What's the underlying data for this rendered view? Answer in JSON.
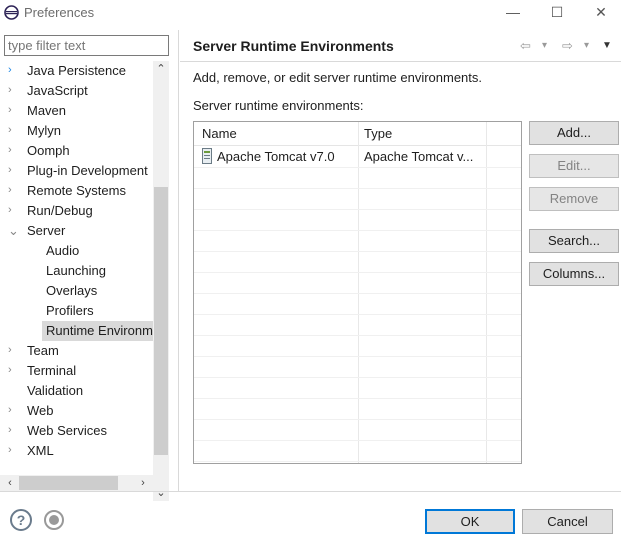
{
  "window": {
    "title": "Preferences",
    "minimize_glyph": "—",
    "maximize_glyph": "☐",
    "close_glyph": "✕"
  },
  "filter": {
    "placeholder": "type filter text",
    "value": ""
  },
  "tree": {
    "items": [
      {
        "label": "Java Persistence",
        "level": 0,
        "expander": "›",
        "expanded": false,
        "selected": false
      },
      {
        "label": "JavaScript",
        "level": 0,
        "expander": "›",
        "expanded": false,
        "selected": false
      },
      {
        "label": "Maven",
        "level": 0,
        "expander": "›",
        "expanded": false,
        "selected": false
      },
      {
        "label": "Mylyn",
        "level": 0,
        "expander": "›",
        "expanded": false,
        "selected": false
      },
      {
        "label": "Oomph",
        "level": 0,
        "expander": "›",
        "expanded": false,
        "selected": false
      },
      {
        "label": "Plug-in Development",
        "level": 0,
        "expander": "›",
        "expanded": false,
        "selected": false
      },
      {
        "label": "Remote Systems",
        "level": 0,
        "expander": "›",
        "expanded": false,
        "selected": false
      },
      {
        "label": "Run/Debug",
        "level": 0,
        "expander": "›",
        "expanded": false,
        "selected": false
      },
      {
        "label": "Server",
        "level": 0,
        "expander": "⌄",
        "expanded": true,
        "selected": false
      },
      {
        "label": "Audio",
        "level": 1,
        "expander": "",
        "expanded": false,
        "selected": false
      },
      {
        "label": "Launching",
        "level": 1,
        "expander": "",
        "expanded": false,
        "selected": false
      },
      {
        "label": "Overlays",
        "level": 1,
        "expander": "",
        "expanded": false,
        "selected": false
      },
      {
        "label": "Profilers",
        "level": 1,
        "expander": "",
        "expanded": false,
        "selected": false
      },
      {
        "label": "Runtime Environm",
        "level": 1,
        "expander": "",
        "expanded": false,
        "selected": true
      },
      {
        "label": "Team",
        "level": 0,
        "expander": "›",
        "expanded": false,
        "selected": false
      },
      {
        "label": "Terminal",
        "level": 0,
        "expander": "›",
        "expanded": false,
        "selected": false
      },
      {
        "label": "Validation",
        "level": 0,
        "expander": "",
        "expanded": false,
        "selected": false
      },
      {
        "label": "Web",
        "level": 0,
        "expander": "›",
        "expanded": false,
        "selected": false
      },
      {
        "label": "Web Services",
        "level": 0,
        "expander": "›",
        "expanded": false,
        "selected": false
      },
      {
        "label": "XML",
        "level": 0,
        "expander": "›",
        "expanded": false,
        "selected": false
      }
    ]
  },
  "page": {
    "title": "Server Runtime Environments",
    "description": "Add, remove, or edit server runtime environments.",
    "list_caption": "Server runtime environments:",
    "nav": {
      "back": "⇦",
      "back_menu": "▾",
      "forward": "⇨",
      "forward_menu": "▾",
      "view_menu": "▼"
    }
  },
  "table": {
    "columns": [
      "Name",
      "Type"
    ],
    "rows": [
      {
        "name": "Apache Tomcat v7.0",
        "type": "Apache Tomcat v...",
        "icon": "server-icon"
      }
    ]
  },
  "buttons": {
    "add": {
      "label": "Add...",
      "enabled": true
    },
    "edit": {
      "label": "Edit...",
      "enabled": false
    },
    "remove": {
      "label": "Remove",
      "enabled": false
    },
    "search": {
      "label": "Search...",
      "enabled": true
    },
    "columns": {
      "label": "Columns...",
      "enabled": true
    }
  },
  "footer": {
    "help_glyph": "?",
    "ok_label": "OK",
    "cancel_label": "Cancel"
  },
  "colors": {
    "accent": "#0078d7",
    "selection": "#d9d9d9",
    "expander": "#1e88e5"
  }
}
